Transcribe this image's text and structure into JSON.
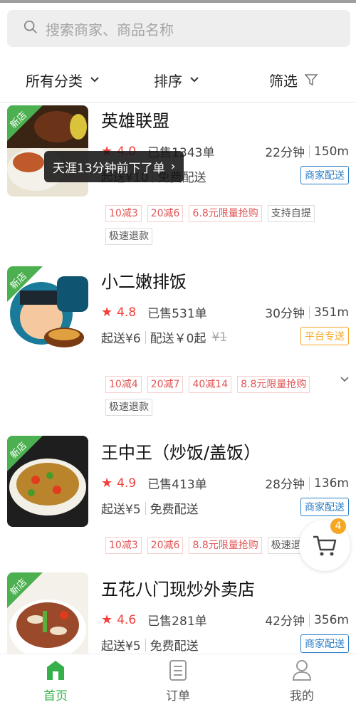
{
  "search": {
    "placeholder": "搜索商家、商品名称",
    "icon": "search-icon"
  },
  "filters": {
    "category": "所有分类",
    "sort": "排序",
    "filter": "筛选"
  },
  "ribbon_label": "新店",
  "toast": {
    "text": "天涯13分钟前下了单",
    "arrow": "›"
  },
  "shops": [
    {
      "name": "英雄联盟",
      "rating": "4.0",
      "sold": "已售1343单",
      "time": "22分钟",
      "distance": "150m",
      "min_order": "起送¥10",
      "delivery_fee": "免费配送",
      "badge": "商家配送",
      "tags": [
        "10减3",
        "20减6",
        "6.8元限量抢购",
        "支持自提",
        "极速退款"
      ]
    },
    {
      "name": "小二嫩排饭",
      "rating": "4.8",
      "sold": "已售531单",
      "time": "30分钟",
      "distance": "351m",
      "min_order": "起送¥6",
      "delivery_fee": "配送￥0起",
      "original_fee": "¥1",
      "badge": "平台专送",
      "tags": [
        "10减4",
        "20减7",
        "40减14",
        "8.8元限量抢购",
        "极速退款"
      ]
    },
    {
      "name": "王中王（炒饭/盖饭）",
      "rating": "4.9",
      "sold": "已售413单",
      "time": "28分钟",
      "distance": "136m",
      "min_order": "起送¥5",
      "delivery_fee": "免费配送",
      "badge": "商家配送",
      "tags": [
        "10减3",
        "20减6",
        "8.8元限量抢购",
        "极速退款"
      ]
    },
    {
      "name": "五花八门现炒外卖店",
      "rating": "4.6",
      "sold": "已售281单",
      "time": "42分钟",
      "distance": "356m",
      "min_order": "起送¥5",
      "delivery_fee": "免费配送",
      "badge": "商家配送"
    }
  ],
  "cart": {
    "count": "4"
  },
  "tabbar": {
    "home": "首页",
    "orders": "订单",
    "mine": "我的"
  },
  "colors": {
    "accent": "#36b04a",
    "rating": "#f0403c",
    "blue_badge": "#2a7ec8",
    "orange_badge": "#f5a623"
  }
}
